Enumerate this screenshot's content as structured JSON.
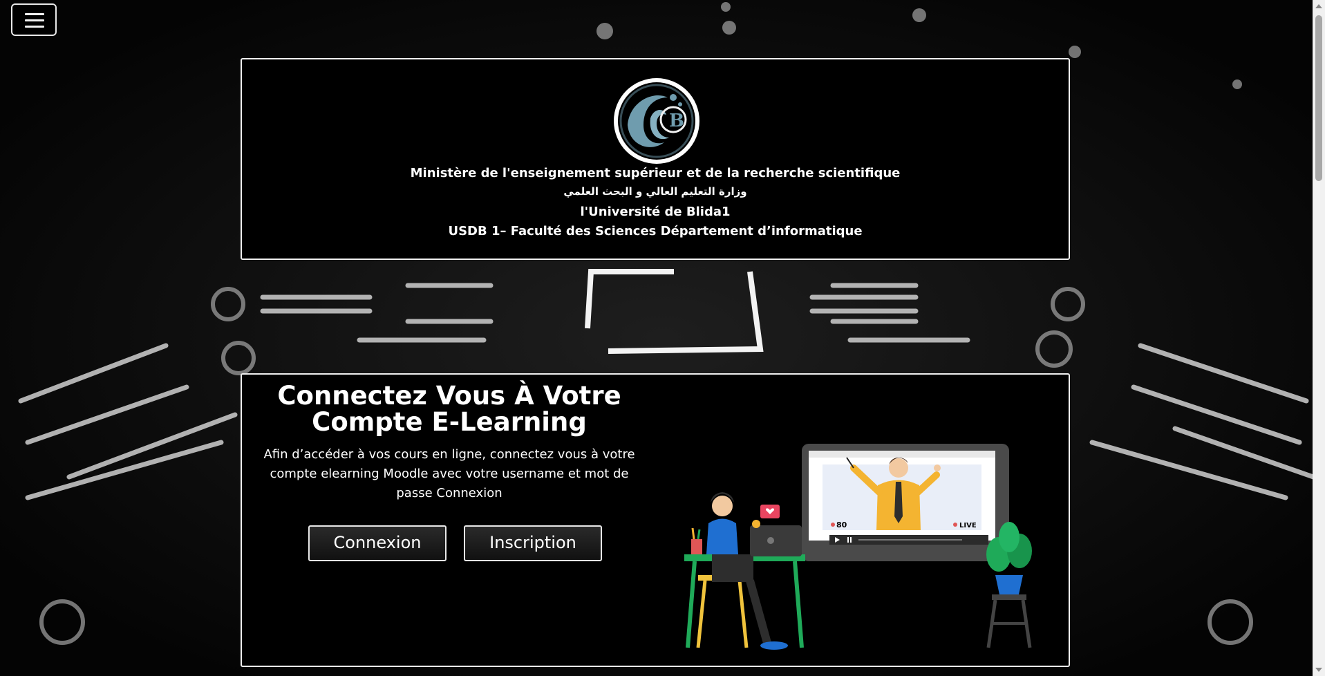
{
  "header": {
    "line1": "Ministère de l'enseignement supérieur et de la recherche scientifique",
    "line2": "وزارة التعليم العالي و البحث العلمي",
    "line3": "l'Université de Blida1",
    "line4": "USDB 1– Faculté des Sciences Département d’informatique",
    "logo_icon": "university-logo"
  },
  "hero": {
    "title_line1": "Connectez Vous À Votre",
    "title_line2": "Compte E-Learning",
    "description": "Afin d’accéder à vos cours en ligne, connectez vous à votre compte elearning Moodle avec votre username et mot de passe Connexion",
    "login_label": "Connexion",
    "signup_label": "Inscription"
  },
  "illustration": {
    "viewers": "80",
    "live": "LIVE"
  },
  "nav": {
    "menu_icon": "hamburger-icon"
  },
  "colors": {
    "background": "#050505",
    "border": "#f0f0f0",
    "text": "#ffffff"
  }
}
